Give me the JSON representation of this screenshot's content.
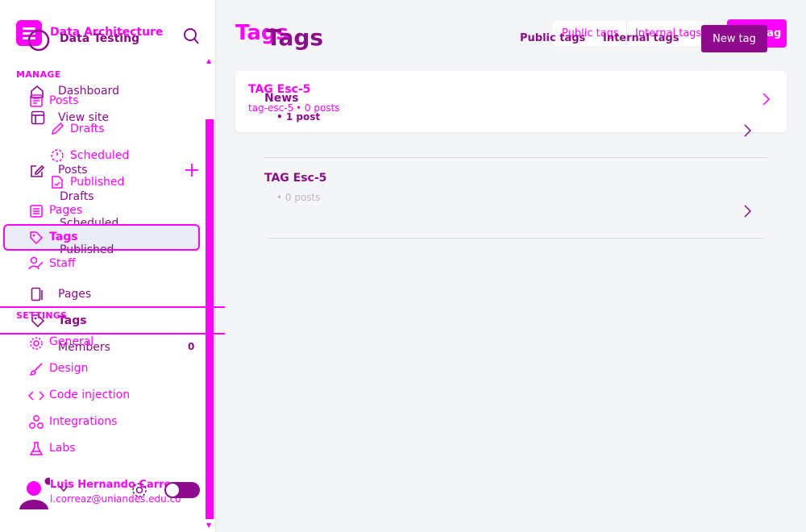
{
  "site": {
    "title_a": "Data Architecture",
    "title_b": "Data Testing"
  },
  "sidebar": {
    "manage_label": "MANAGE",
    "settings_label": "SETTINGS",
    "nav_a": {
      "posts": "Posts",
      "drafts": "Drafts",
      "scheduled": "Scheduled",
      "published": "Published",
      "pages": "Pages",
      "tags": "Tags",
      "staff": "Staff",
      "general": "General",
      "design": "Design",
      "code_injection": "Code injection",
      "integrations": "Integrations",
      "labs": "Labs"
    },
    "nav_b": {
      "dashboard": "Dashboard",
      "view_site": "View site",
      "posts": "Posts",
      "drafts": "Drafts",
      "scheduled": "Scheduled",
      "published": "Published",
      "pages": "Pages",
      "tags": "Tags",
      "members": "Members",
      "members_count": "0"
    },
    "user": {
      "name": "Luis Hernando Carre",
      "email": "l.correaz@uniandes.edu.co"
    }
  },
  "main": {
    "title_a": "Tags",
    "title_b": "Tags",
    "filters_a": {
      "public": "Public tags",
      "internal": "Internal tags"
    },
    "filters_b": {
      "public": "Public tags",
      "internal": "Internal tags"
    },
    "new_tag_a": "New tag",
    "new_tag_b": "New tag",
    "list_a": [
      {
        "name": "TAG Esc-5",
        "slug": "tag-esc-5",
        "count": "• 0 posts"
      }
    ],
    "list_b": [
      {
        "name": "News",
        "count": "• 1 post"
      },
      {
        "name": "TAG Esc-5",
        "count": "• 0 posts"
      }
    ]
  },
  "colors": {
    "accent_magenta": "#ff00ff",
    "accent_purple": "#8e0b8e",
    "background": "#f4f5f7"
  }
}
